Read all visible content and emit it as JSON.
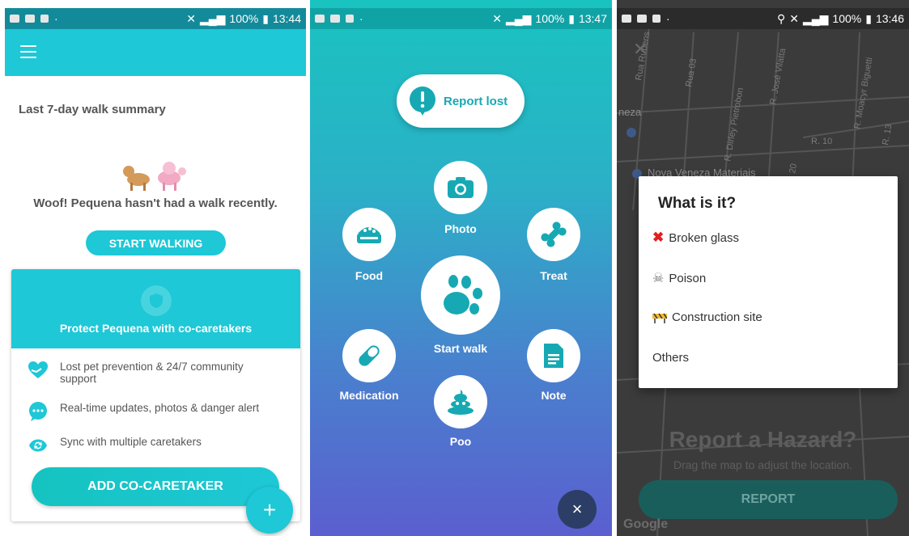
{
  "screen1": {
    "status": {
      "battery": "100%",
      "time": "13:44"
    },
    "summary_title": "Last 7-day walk summary",
    "woof_text": "Woof! Pequena hasn't had a walk recently.",
    "start_walking": "START WALKING",
    "card_title": "Protect Pequena with co-caretakers",
    "features": [
      {
        "text": "Lost pet prevention & 24/7 community support",
        "icon": "heart-hand-icon"
      },
      {
        "text": "Real-time updates, photos & danger alert",
        "icon": "chat-bubble-icon"
      },
      {
        "text": "Sync with multiple caretakers",
        "icon": "sync-icon"
      }
    ],
    "add_button": "ADD CO-CARETAKER",
    "fab": "+"
  },
  "screen2": {
    "status": {
      "battery": "100%",
      "time": "13:47"
    },
    "report_lost": "Report lost",
    "actions": {
      "photo": "Photo",
      "food": "Food",
      "treat": "Treat",
      "start_walk": "Start walk",
      "medication": "Medication",
      "note": "Note",
      "poo": "Poo"
    },
    "close": "×"
  },
  "screen3": {
    "status": {
      "battery": "100%",
      "time": "13:46"
    },
    "dialog_title": "What is it?",
    "options": [
      "Broken glass",
      "Poison",
      "Construction site",
      "Others"
    ],
    "hazard_title": "Report a Hazard?",
    "hazard_sub": "Drag the map to adjust the location.",
    "report_button": "REPORT",
    "google": "Google",
    "map_labels": [
      "Rua Rubens Groff",
      "Rua 03",
      "R. Dirley Pietrobon",
      "R. José Vilatta",
      "R. Moacyr Biguetti",
      "R. 10",
      "R. 13",
      "Nova Veneza Materiais",
      "neza",
      "20"
    ]
  },
  "colors": {
    "teal": "#1ec8d6",
    "dark_navy": "#2c3e66"
  }
}
